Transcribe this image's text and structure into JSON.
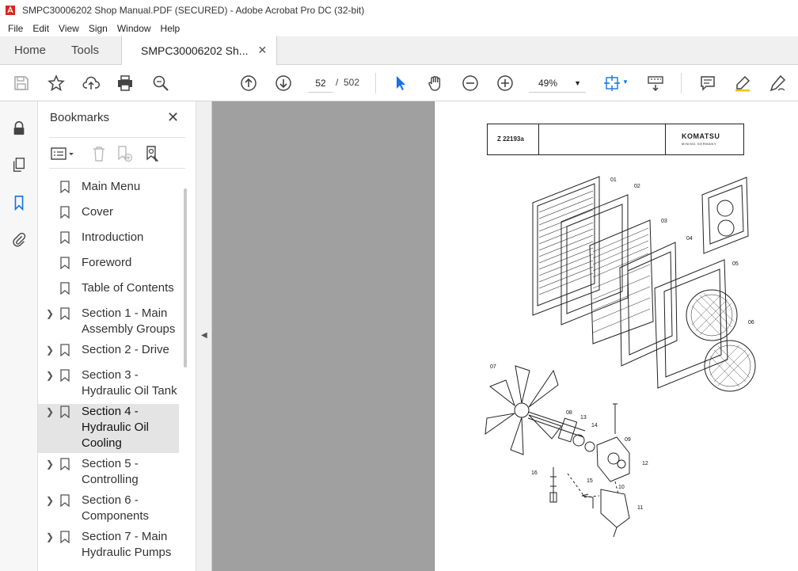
{
  "window": {
    "title": "SMPC30006202 Shop Manual.PDF (SECURED) - Adobe Acrobat Pro DC (32-bit)"
  },
  "menu": [
    "File",
    "Edit",
    "View",
    "Sign",
    "Window",
    "Help"
  ],
  "tabs": {
    "home": "Home",
    "tools": "Tools",
    "document": "SMPC30006202 Sh..."
  },
  "toolbar": {
    "current_page": "52",
    "page_sep": "/",
    "total_pages": "502",
    "zoom": "49%"
  },
  "bookmarks": {
    "title": "Bookmarks",
    "items": [
      {
        "label": "Main Menu",
        "expandable": false
      },
      {
        "label": "Cover",
        "expandable": false
      },
      {
        "label": "Introduction",
        "expandable": false
      },
      {
        "label": "Foreword",
        "expandable": false
      },
      {
        "label": "Table of Contents",
        "expandable": false
      },
      {
        "line1": "Section 1 - Main",
        "line2": "Assembly Groups",
        "expandable": true
      },
      {
        "line1": "Section 2 - Drive",
        "expandable": true
      },
      {
        "line1": "Section 3 -",
        "line2": "Hydraulic Oil Tank",
        "expandable": true
      },
      {
        "line1": "Section 4 -",
        "line2": "Hydraulic Oil",
        "line3": "Cooling",
        "expandable": true,
        "selected": true
      },
      {
        "line1": "Section 5 -",
        "line2": "Controlling",
        "expandable": true
      },
      {
        "line1": "Section 6 -",
        "line2": "Components",
        "expandable": true
      },
      {
        "line1": "Section 7 - Main",
        "line2": "Hydraulic Pumps",
        "expandable": true
      }
    ]
  },
  "document": {
    "header_code": "Z 22193a",
    "brand": "KOMATSU",
    "brand_sub": "MINING GERMANY",
    "part_labels": [
      "01",
      "02",
      "03",
      "04",
      "05",
      "06",
      "07",
      "08",
      "13",
      "14",
      "09",
      "10",
      "12",
      "15",
      "16",
      "11"
    ]
  },
  "colors": {
    "accent": "#1473e6",
    "doc_bg": "#a0a0a0",
    "selected_bg": "#e4e4e4"
  }
}
